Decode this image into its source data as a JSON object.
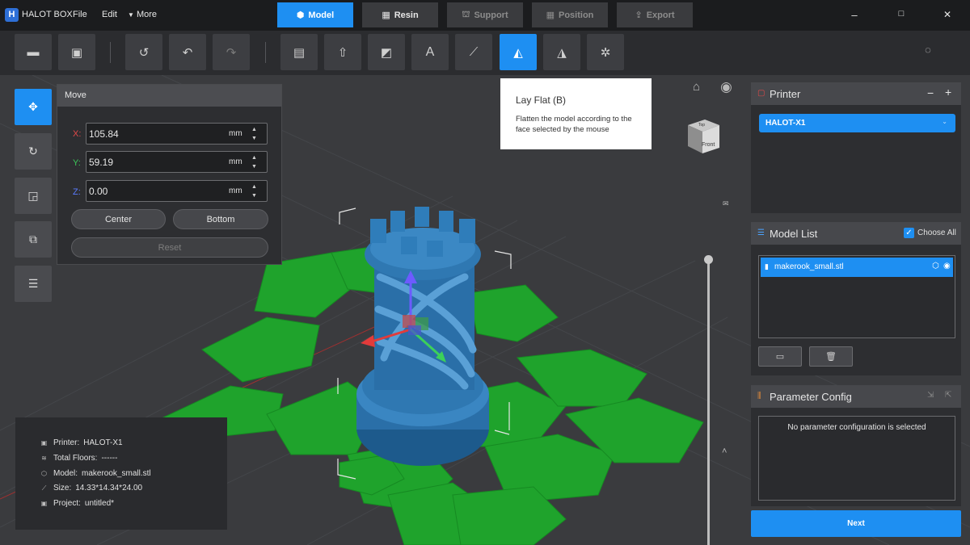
{
  "app": {
    "title": "HALOT BOX",
    "logo_glyph": "H"
  },
  "menu": {
    "file": "File",
    "edit": "Edit",
    "more": "More"
  },
  "steps": [
    {
      "label": "Model",
      "icon": "model-icon",
      "state": "active"
    },
    {
      "label": "Resin",
      "icon": "resin-icon",
      "state": "done"
    },
    {
      "label": "Support",
      "icon": "support-icon",
      "state": "disabled"
    },
    {
      "label": "Position",
      "icon": "position-icon",
      "state": "disabled"
    },
    {
      "label": "Export",
      "icon": "export-icon",
      "state": "disabled"
    }
  ],
  "window": {
    "minimize": "–",
    "maximize": "□",
    "close": "✕"
  },
  "toolbar": {
    "tools": [
      "open-folder-icon",
      "open-project-icon",
      "history-icon",
      "undo-icon",
      "redo-icon",
      "print-icon",
      "export-model-icon",
      "cut-icon",
      "text-icon",
      "measure-icon",
      "lay-flat-icon",
      "mirror-icon",
      "auto-arrange-icon"
    ],
    "active_tool": "lay-flat-icon"
  },
  "move_panel": {
    "title": "Move",
    "x_label": "X:",
    "x_value": "105.84",
    "y_label": "Y:",
    "y_value": "59.19",
    "z_label": "Z:",
    "z_value": "0.00",
    "unit": "mm",
    "center_label": "Center",
    "bottom_label": "Bottom",
    "reset_label": "Reset"
  },
  "tooltip": {
    "title": "Lay Flat (B)",
    "body": "Flatten the model according to the face selected by the mouse"
  },
  "view_cube": {
    "top_label": "Top",
    "front_label": "Front"
  },
  "layer_slider": {
    "top_fraction": 1.0,
    "bottom_fraction": 0.0
  },
  "info": {
    "printer_key": "Printer:",
    "printer_val": "HALOT-X1",
    "floors_key": "Total Floors:",
    "floors_val": "------",
    "model_key": "Model:",
    "model_val": "makerook_small.stl",
    "size_key": "Size:",
    "size_val": "14.33*14.34*24.00",
    "project_key": "Project:",
    "project_val": "untitled*"
  },
  "printer_panel": {
    "title": "Printer",
    "minus": "−",
    "plus": "+",
    "selected": "HALOT-X1"
  },
  "model_list": {
    "title": "Model List",
    "choose_all": "Choose All",
    "items": [
      {
        "name": "makerook_small.stl"
      }
    ]
  },
  "param_config": {
    "title": "Parameter Config",
    "empty_msg": "No parameter configuration is selected"
  },
  "next_label": "Next",
  "colors": {
    "accent": "#1e8ff2",
    "plate_green": "#1fa32c",
    "model_blue": "#2a6fa8",
    "panel_bg": "#2d2e31"
  }
}
